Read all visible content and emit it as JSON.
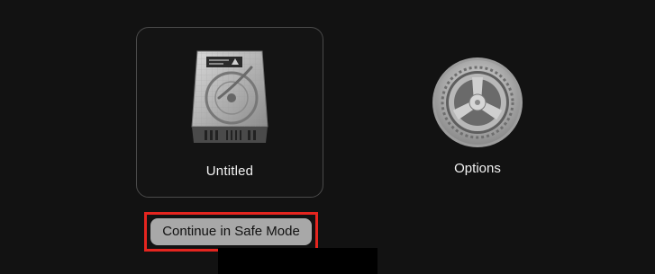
{
  "startup_disk": {
    "label": "Untitled",
    "icon": "hard-drive-icon"
  },
  "options": {
    "label": "Options",
    "icon": "gear-icon"
  },
  "safe_mode": {
    "button_label": "Continue in Safe Mode",
    "highlight_color": "#e4251f"
  },
  "colors": {
    "background": "#121212",
    "text": "#f2f2f2",
    "button_bg": "#a8a8a8"
  }
}
